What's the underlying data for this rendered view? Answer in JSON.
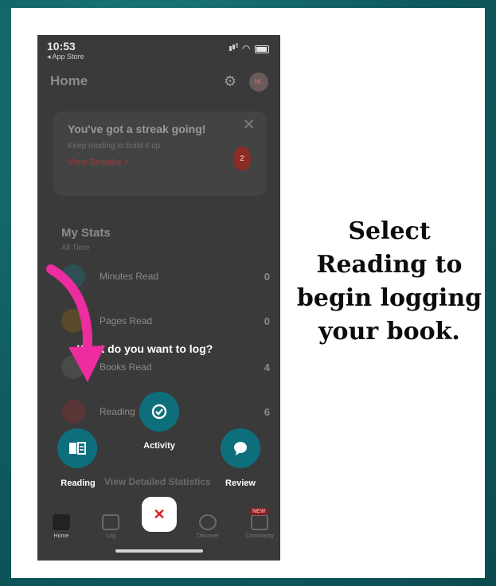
{
  "status_bar": {
    "time": "10:53",
    "back_label": "◂ App Store"
  },
  "header": {
    "title": "Home",
    "avatar_initials": "HL"
  },
  "streak_card": {
    "title": "You've got a streak going!",
    "subtitle": "Keep reading to build it up.",
    "link": "View Streaks  >",
    "count": "2"
  },
  "stats": {
    "title": "My Stats",
    "subtitle": "All Time",
    "rows": [
      {
        "label": "Minutes Read",
        "value": "0"
      },
      {
        "label": "Pages Read",
        "value": "0"
      },
      {
        "label": "Books Read",
        "value": "4"
      },
      {
        "label": "Reading",
        "value": "6"
      }
    ],
    "detailed_link": "View Detailed Statistics"
  },
  "log_menu": {
    "prompt": "What do you want to log?",
    "options": {
      "reading": "Reading",
      "activity": "Activity",
      "review": "Review"
    }
  },
  "tabbar": {
    "home": "Home",
    "log": "Log",
    "discover": "Discover",
    "community": "Community",
    "new_badge": "NEW"
  },
  "caption": "Select Reading to begin logging your book.",
  "colors": {
    "accent": "#0d6f7c",
    "arrow": "#ec2c9f",
    "close": "#d61f26"
  }
}
